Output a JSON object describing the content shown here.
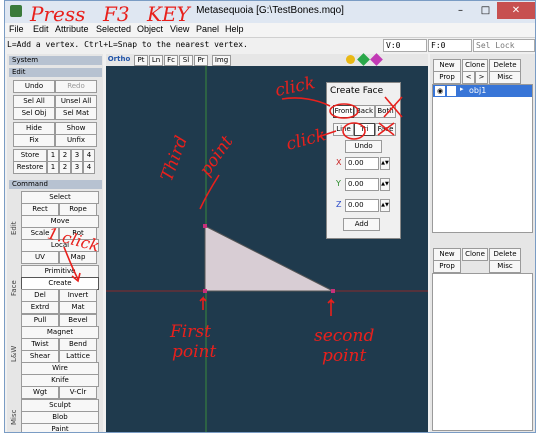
{
  "window": {
    "title": "Metasequoia [G:\\TestBones.mqo]",
    "minimize": "–",
    "maximize": "□",
    "close": "✕"
  },
  "menu": [
    "File",
    "Edit",
    "Attribute",
    "Selected",
    "Object",
    "View",
    "Panel",
    "Help"
  ],
  "status": {
    "hint": "L=Add a vertex.  Ctrl+L=Snap to the nearest vertex.",
    "v": "V:0",
    "f": "F:0",
    "sel_lock": "Sel Lock"
  },
  "left": {
    "system": "System",
    "edit": "Edit",
    "command": "Command",
    "undo": "Undo",
    "redo": "Redo",
    "sel_all": "Sel All",
    "unsel_all": "Unsel All",
    "sel_obj": "Sel Obj",
    "sel_mat": "Sel Mat",
    "hide": "Hide",
    "show": "Show",
    "fix": "Fix",
    "unfix": "Unfix",
    "store": "Store",
    "restore": "Restore",
    "nums": [
      "1",
      "2",
      "3",
      "4"
    ],
    "group_edit": "Edit",
    "select": "Select",
    "rect": "Rect",
    "rope": "Rope",
    "move": "Move",
    "scale": "Scale",
    "rot": "Rot",
    "local": "Local",
    "uv": "UV",
    "map": "Map",
    "group_face": "Face",
    "primitive": "Primitive",
    "create": "Create",
    "del": "Del",
    "invert": "Invert",
    "extrd": "Extrd",
    "mat": "Mat",
    "group_law": "L&W",
    "pull": "Pull",
    "bevel": "Bevel",
    "magnet": "Magnet",
    "twist": "Twist",
    "bend": "Bend",
    "shear": "Shear",
    "lattice": "Lattice",
    "wire": "Wire",
    "knife": "Knife",
    "wgt": "Wgt",
    "vclr": "V-Clr",
    "group_misc": "Misc",
    "sculpt": "Sculpt",
    "blob": "Blob",
    "paint": "Paint"
  },
  "view": {
    "tabs": [
      "Ortho",
      "Pt",
      "Ln",
      "Fc",
      "Sl",
      "Pr"
    ],
    "img": "Img"
  },
  "create_face": {
    "title": "Create Face",
    "front": "Front",
    "back": "Back",
    "both": "Both",
    "line": "Line",
    "tri": "Tri",
    "face": "Face",
    "undo": "Undo",
    "x_label": "X",
    "y_label": "Y",
    "z_label": "Z",
    "x": "0.00",
    "y": "0.00",
    "z": "0.00",
    "add": "Add"
  },
  "right": {
    "new": "New",
    "clone": "Clone",
    "delete": "Delete",
    "prop": "Prop",
    "lt": "<",
    "gt": ">",
    "misc": "Misc",
    "obj": "obj1"
  },
  "annotations": {
    "press": "Press",
    "f3": "F3",
    "key": "KEY",
    "click1": "click",
    "click2": "click",
    "third": "Third",
    "point_a": "point",
    "one_click": "1.click",
    "first": "First",
    "point_b": "point",
    "second": "second",
    "point_c": "point"
  },
  "colors": {
    "annotation": "#e8201c",
    "viewport": "#1f3a4d",
    "triangle": "#d8cdd4"
  }
}
